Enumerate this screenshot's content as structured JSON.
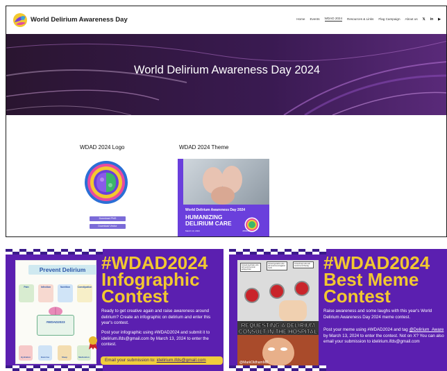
{
  "site": {
    "logo_text": "World Delirium Awareness Day",
    "menu": [
      "Home",
      "Events",
      "WDAD 2024",
      "Resources & Links",
      "Flag Campaign",
      "About us"
    ],
    "active_menu_index": 2,
    "social": [
      "twitter-icon",
      "linkedin-icon",
      "youtube-icon"
    ],
    "hero_title": "World Delirium Awareness Day 2024",
    "logo_section_label": "WDAD 2024 Logo",
    "theme_section_label": "WDAD 2024 Theme",
    "download_png": "Download PNG",
    "download_vector": "Download Vector",
    "theme_card": {
      "title": "World Delirium Awareness Day 2024",
      "subtitle_line1": "HUMANIZING",
      "subtitle_line2": "DELIRIUM CARE",
      "date": "March 13, 2024",
      "hashtag": "#WDAD2024"
    }
  },
  "infographic": {
    "heading_line1": "#WDAD2024",
    "heading_line2": "Infographic",
    "heading_line3": "Contest",
    "para1": "Ready to get creative again and raise awareness around delirium? Create an infographic on delirium and enter this year's contest.",
    "para2": "Post your infographic using #WDAD2024 and submit it to idelirium.ifds@gmail.com by March 13, 2024 to enter the contest.",
    "email_label": "Email your submission to:",
    "email": "idelirium.ifds@gmail.com",
    "card": {
      "title": "Prevent Delirium",
      "cells": [
        "Pain",
        "Infection",
        "Nutrition",
        "Constipation"
      ],
      "center": "#WDAD2023",
      "foot": [
        "Hydration",
        "Exercise",
        "Sleep",
        "Medication"
      ]
    }
  },
  "meme": {
    "heading_line1": "#WDAD2024",
    "heading_line2": "Best Meme",
    "heading_line3": "Contest",
    "para1": "Raise awareness and some laughs with this year's World Delirium Awareness Day 2024 meme contest.",
    "para2_prefix": "Post your meme using #WDAD2024 and tag",
    "para2_tag": "@Delirium_Aware",
    "para2_suffix": "by March 13, 2024 to enter the contest. Not on X? You can also email your submission to idelirium.ifds@gmail.com",
    "card": {
      "caption": "REQUESTING A DELIRIUM CONSULT IN THE HOSPITAL",
      "handle": "@MarkOldhamMD",
      "speech": [
        "Consult psychiatry who will recommend an antipsychotic",
        "Consult geriatrics who will recommend against meds",
        "Consult dept who will recommend therapy"
      ]
    }
  },
  "colors": {
    "panel_purple": "#5b1fb0",
    "heading_yellow": "#f2c830",
    "button_purple": "#7b6bd8"
  }
}
